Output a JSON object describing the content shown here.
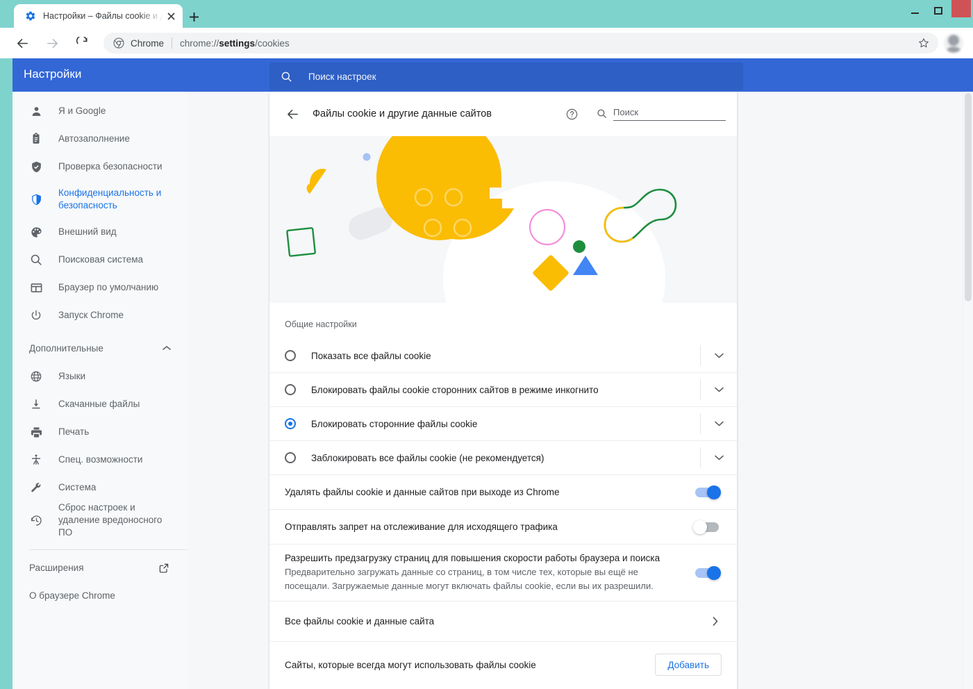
{
  "browser": {
    "tab": {
      "title": "Настройки – Файлы cookie и др",
      "favicon": "settings-gear-icon",
      "close": "×"
    },
    "new_tab_label": "+",
    "nav": {
      "back": "←",
      "forward": "→",
      "reload": "⟳"
    },
    "omnibox": {
      "chip_label": "Chrome",
      "url_prefix": "chrome://",
      "url_bold": "settings",
      "url_suffix": "/cookies"
    },
    "window_controls": {
      "minimize": "—",
      "maximize": "▢",
      "close": "✕"
    }
  },
  "settings": {
    "title": "Настройки",
    "global_search_placeholder": "Поиск настроек"
  },
  "sidebar": {
    "items": [
      {
        "label": "Я и Google",
        "icon": "person-icon",
        "active": false
      },
      {
        "label": "Автозаполнение",
        "icon": "clipboard-icon",
        "active": false
      },
      {
        "label": "Проверка безопасности",
        "icon": "shield-check-icon",
        "active": false
      },
      {
        "label": "Конфиденциальность и безопасность",
        "icon": "shield-icon",
        "active": true
      },
      {
        "label": "Внешний вид",
        "icon": "palette-icon",
        "active": false
      },
      {
        "label": "Поисковая система",
        "icon": "search-icon",
        "active": false
      },
      {
        "label": "Браузер по умолчанию",
        "icon": "window-icon",
        "active": false
      },
      {
        "label": "Запуск Chrome",
        "icon": "power-icon",
        "active": false
      }
    ],
    "advanced_group": {
      "label": "Дополнительные",
      "expanded": true
    },
    "advanced_items": [
      {
        "label": "Языки",
        "icon": "globe-icon"
      },
      {
        "label": "Скачанные файлы",
        "icon": "download-icon"
      },
      {
        "label": "Печать",
        "icon": "printer-icon"
      },
      {
        "label": "Спец. возможности",
        "icon": "accessibility-icon"
      },
      {
        "label": "Система",
        "icon": "wrench-icon"
      },
      {
        "label": "Сброс настроек и удаление вредоносного ПО",
        "icon": "history-restore-icon"
      }
    ],
    "footer_items": [
      {
        "label": "Расширения",
        "icon": "external-link-icon"
      },
      {
        "label": "О браузере Chrome",
        "icon": ""
      }
    ]
  },
  "content": {
    "back_label": "←",
    "page_title": "Файлы cookie и другие данные сайтов",
    "help_icon": "help-circle-icon",
    "search_placeholder": "Поиск",
    "illustration": "cookie-illustration",
    "section_label": "Общие настройки",
    "radio_options": [
      {
        "label": "Показать все файлы cookie",
        "selected": false
      },
      {
        "label": "Блокировать файлы cookie сторонних сайтов в режиме инкогнито",
        "selected": false
      },
      {
        "label": "Блокировать сторонние файлы cookie",
        "selected": true
      },
      {
        "label": "Заблокировать все файлы cookie (не рекомендуется)",
        "selected": false
      }
    ],
    "toggles": [
      {
        "title": "Удалять файлы cookie и данные сайтов при выходе из Chrome",
        "sub": "",
        "on": true
      },
      {
        "title": "Отправлять запрет на отслеживание для исходящего трафика",
        "sub": "",
        "on": false
      },
      {
        "title": "Разрешить предзагрузку страниц для повышения скорости работы браузера и поиска",
        "sub": "Предварительно загружать данные со страниц, в том числе тех, которые вы ещё не посещали. Загружаемые данные могут включать файлы cookie, если вы их разрешили.",
        "on": true
      }
    ],
    "link_row": {
      "label": "Все файлы cookie и данные сайта",
      "caret": "›"
    },
    "add_row": {
      "label": "Сайты, которые всегда могут использовать файлы cookie",
      "button": "Добавить"
    }
  },
  "colors": {
    "window_frame_teal": "#7fd3cd",
    "settings_header_blue": "#3367d6",
    "accent_blue": "#1a73e8",
    "page_bg": "#f5f7f9",
    "sidebar_bg": "#f7f9fa",
    "close_button_red": "#cf5356",
    "cookie_yellow": "#fbbc04",
    "green": "#1e8e3e",
    "blue_triangle": "#4285f4",
    "pink_circle": "#f48fdc"
  }
}
